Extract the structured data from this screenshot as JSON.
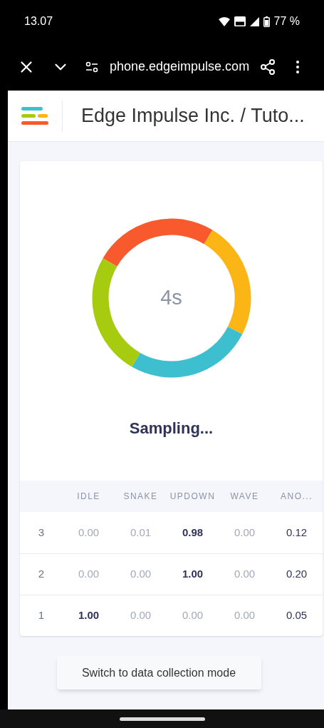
{
  "status_bar": {
    "time": "13.07",
    "battery": "77 %"
  },
  "browser_bar": {
    "url": "phone.edgeimpulse.com"
  },
  "header": {
    "title": "Edge Impulse Inc. / Tuto..."
  },
  "sampler": {
    "timer": "4s",
    "status": "Sampling..."
  },
  "table": {
    "columns": [
      {
        "label": "IDLE",
        "kind": "class"
      },
      {
        "label": "SNAKE",
        "kind": "class"
      },
      {
        "label": "UPDOWN",
        "kind": "class"
      },
      {
        "label": "WAVE",
        "kind": "class"
      },
      {
        "label": "ANO...",
        "kind": "anomaly"
      }
    ],
    "rows": [
      {
        "index": "3",
        "cells": [
          {
            "value": "0.00",
            "top": false
          },
          {
            "value": "0.01",
            "top": false
          },
          {
            "value": "0.98",
            "top": true
          },
          {
            "value": "0.00",
            "top": false
          },
          {
            "value": "0.12",
            "top": false
          }
        ]
      },
      {
        "index": "2",
        "cells": [
          {
            "value": "0.00",
            "top": false
          },
          {
            "value": "0.00",
            "top": false
          },
          {
            "value": "1.00",
            "top": true
          },
          {
            "value": "0.00",
            "top": false
          },
          {
            "value": "0.20",
            "top": false
          }
        ]
      },
      {
        "index": "1",
        "cells": [
          {
            "value": "1.00",
            "top": true
          },
          {
            "value": "0.00",
            "top": false
          },
          {
            "value": "0.00",
            "top": false
          },
          {
            "value": "0.00",
            "top": false
          },
          {
            "value": "0.05",
            "top": false
          }
        ]
      }
    ]
  },
  "action_button": "Switch to data collection mode"
}
